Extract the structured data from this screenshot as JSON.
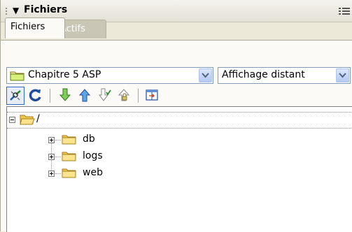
{
  "panel": {
    "title": "Fichiers"
  },
  "tabs": [
    {
      "label": "Fichiers",
      "active": true
    },
    {
      "label": "Actifs",
      "active": false
    }
  ],
  "site_select": {
    "value": "Chapitre 5 ASP"
  },
  "view_select": {
    "value": "Affichage distant"
  },
  "toolbar": {
    "buttons": [
      "connect-icon",
      "refresh-icon",
      "get-files-icon",
      "put-files-icon",
      "check-out-icon",
      "check-in-icon",
      "expand-icon"
    ]
  },
  "tree": {
    "root": {
      "label": "/",
      "expanded": true
    },
    "children": [
      {
        "label": "db",
        "expanded": false
      },
      {
        "label": "logs",
        "expanded": false
      },
      {
        "label": "web",
        "expanded": false
      }
    ]
  },
  "colors": {
    "panel_bg": "#ece9d8",
    "folder": "#f5d66e",
    "accent": "#316ac5"
  }
}
